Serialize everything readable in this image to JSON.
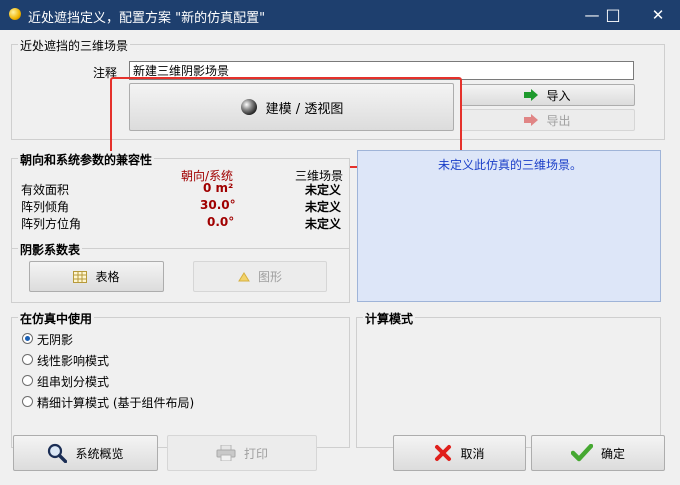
{
  "window": {
    "title": "近处遮挡定义，配置方案 \"新的仿真配置\"",
    "minimize": "—",
    "maximize": "□",
    "close": "✕"
  },
  "scene_group": {
    "title": "近处遮挡的三维场景",
    "comment_label": "注释",
    "comment_value": "新建三维阴影场景",
    "build_button": "建模 / 透视图",
    "import_button": "导入",
    "export_button": "导出"
  },
  "params_group": {
    "title": "朝向和系统参数的兼容性",
    "col_orientation": "朝向/系统",
    "col_scene": "三维场景",
    "rows": [
      {
        "label": "有效面积",
        "orientation": "0 m²",
        "scene": "未定义"
      },
      {
        "label": "阵列倾角",
        "orientation": "30.0°",
        "scene": "未定义"
      },
      {
        "label": "阵列方位角",
        "orientation": "0.0°",
        "scene": "未定义"
      }
    ]
  },
  "info_message": "未定义此仿真的三维场景。",
  "shading_group": {
    "title": "阴影系数表",
    "table_button": "表格",
    "graph_button": "图形"
  },
  "usage_group": {
    "title": "在仿真中使用",
    "options": [
      "无阴影",
      "线性影响模式",
      "组串划分模式",
      "精细计算模式 (基于组件布局)"
    ],
    "selected_index": 0
  },
  "calc_group": {
    "title": "计算模式"
  },
  "footer": {
    "overview_button": "系统概览",
    "print_button": "打印",
    "cancel_button": "取消",
    "ok_button": "确定"
  },
  "colors": {
    "titlebar": "#1e3f6e",
    "highlight": "#e5312b",
    "value_red": "#a00000",
    "info_bg": "#dde6f8",
    "info_text": "#1a3ec8"
  },
  "icons": [
    "app-icon",
    "sphere-icon",
    "import-arrow-icon",
    "export-arrow-icon",
    "table-icon",
    "graph-icon",
    "search-icon",
    "printer-icon",
    "cancel-x-icon",
    "checkmark-icon"
  ]
}
